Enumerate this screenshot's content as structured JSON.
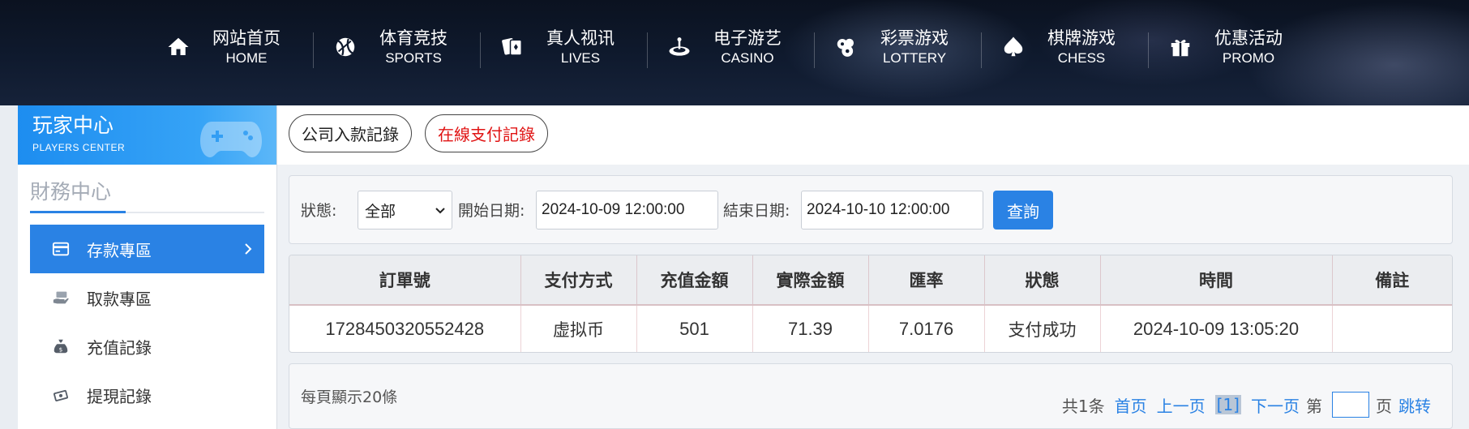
{
  "nav": {
    "items": [
      {
        "cn": "网站首页",
        "en": "HOME",
        "icon": "home-icon"
      },
      {
        "cn": "体育竞技",
        "en": "SPORTS",
        "icon": "ball-icon"
      },
      {
        "cn": "真人视讯",
        "en": "LIVES",
        "icon": "cards-icon"
      },
      {
        "cn": "电子游艺",
        "en": "CASINO",
        "icon": "roulette-icon"
      },
      {
        "cn": "彩票游戏",
        "en": "LOTTERY",
        "icon": "lottery-balls-icon"
      },
      {
        "cn": "棋牌游戏",
        "en": "CHESS",
        "icon": "spade-icon"
      },
      {
        "cn": "优惠活动",
        "en": "PROMO",
        "icon": "gift-icon"
      }
    ]
  },
  "sidebar": {
    "banner_cn": "玩家中心",
    "banner_en": "PLAYERS CENTER",
    "section_title": "財務中心",
    "items": [
      {
        "label": "存款專區",
        "icon": "deposit-card-icon",
        "active": true
      },
      {
        "label": "取款專區",
        "icon": "withdraw-hand-icon",
        "active": false
      },
      {
        "label": "充值記錄",
        "icon": "money-bag-icon",
        "active": false
      },
      {
        "label": "提現記錄",
        "icon": "cash-out-icon",
        "active": false
      }
    ]
  },
  "tabs": {
    "company_deposit": "公司入款記錄",
    "online_payment": "在線支付記錄"
  },
  "filter": {
    "status_label": "狀態:",
    "status_value": "全部",
    "start_label": "開始日期:",
    "start_value": "2024-10-09 12:00:00",
    "end_label": "結束日期:",
    "end_value": "2024-10-10 12:00:00",
    "query_label": "查詢"
  },
  "table": {
    "headers": [
      "訂單號",
      "支付方式",
      "充值金額",
      "實際金額",
      "匯率",
      "狀態",
      "時間",
      "備註"
    ],
    "rows": [
      [
        "1728450320552428",
        "虚拟币",
        "501",
        "71.39",
        "7.0176",
        "支付成功",
        "2024-10-09 13:05:20",
        ""
      ]
    ]
  },
  "pager": {
    "per_page": "每頁顯示20條",
    "total": "共1条",
    "first": "首页",
    "prev": "上一页",
    "current": "[1]",
    "next": "下一页",
    "page_prefix": "第",
    "page_suffix": "页",
    "jump": "跳转"
  },
  "colors": {
    "accent": "#2a82e4",
    "online_tab_text": "#e01414"
  }
}
